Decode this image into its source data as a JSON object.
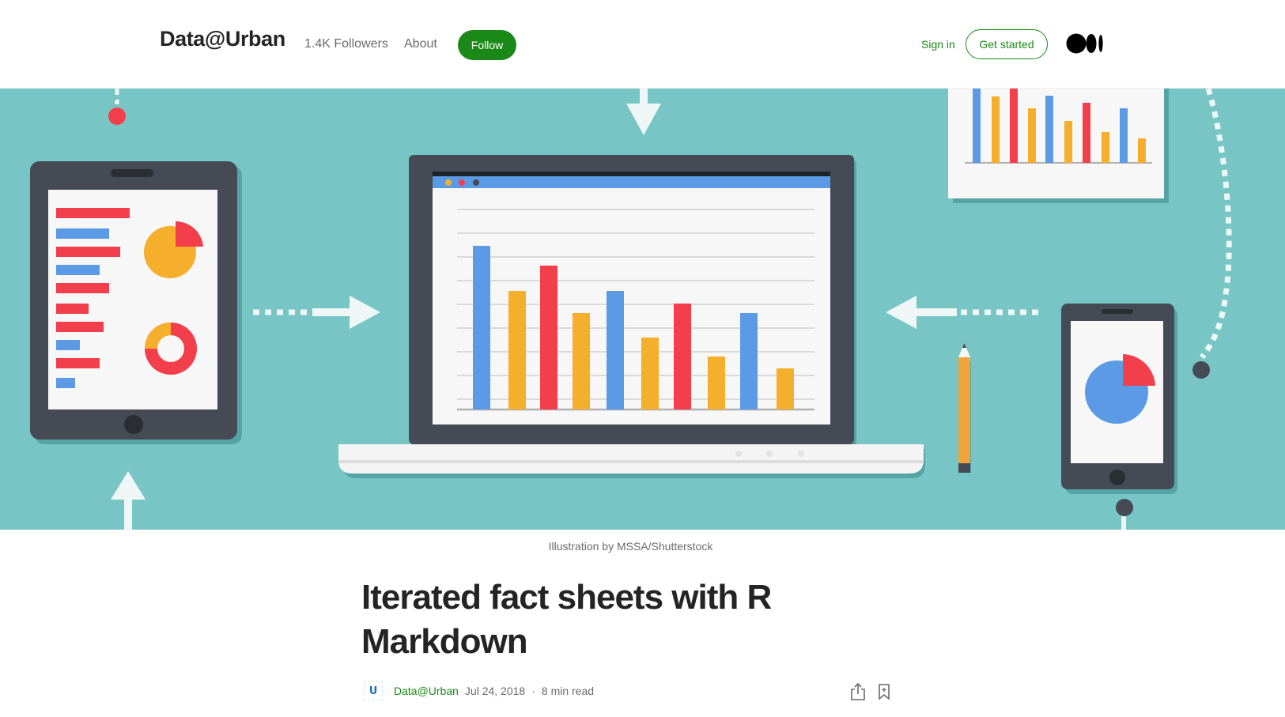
{
  "header": {
    "brand": "Data@Urban",
    "followers": "1.4K Followers",
    "about": "About",
    "follow": "Follow",
    "sign_in": "Sign in",
    "get_started": "Get started",
    "logo_icon": "medium-logo-icon"
  },
  "hero": {
    "caption": "Illustration by MSSA/Shutterstock",
    "background_color": "#77c5c4"
  },
  "article": {
    "title": "Iterated fact sheets with R Markdown",
    "publication": "Data@Urban",
    "publication_avatar_letter": "U",
    "date": "Jul 24, 2018",
    "separator": "·",
    "read_time": "8 min read",
    "share_icon": "share-icon",
    "bookmark_icon": "bookmark-icon"
  },
  "colors": {
    "accent_green": "#1a8917",
    "bar_blue": "#5b9be6",
    "bar_orange": "#f6ae2d",
    "bar_red": "#f33f4b",
    "device_dark": "#454a54"
  }
}
